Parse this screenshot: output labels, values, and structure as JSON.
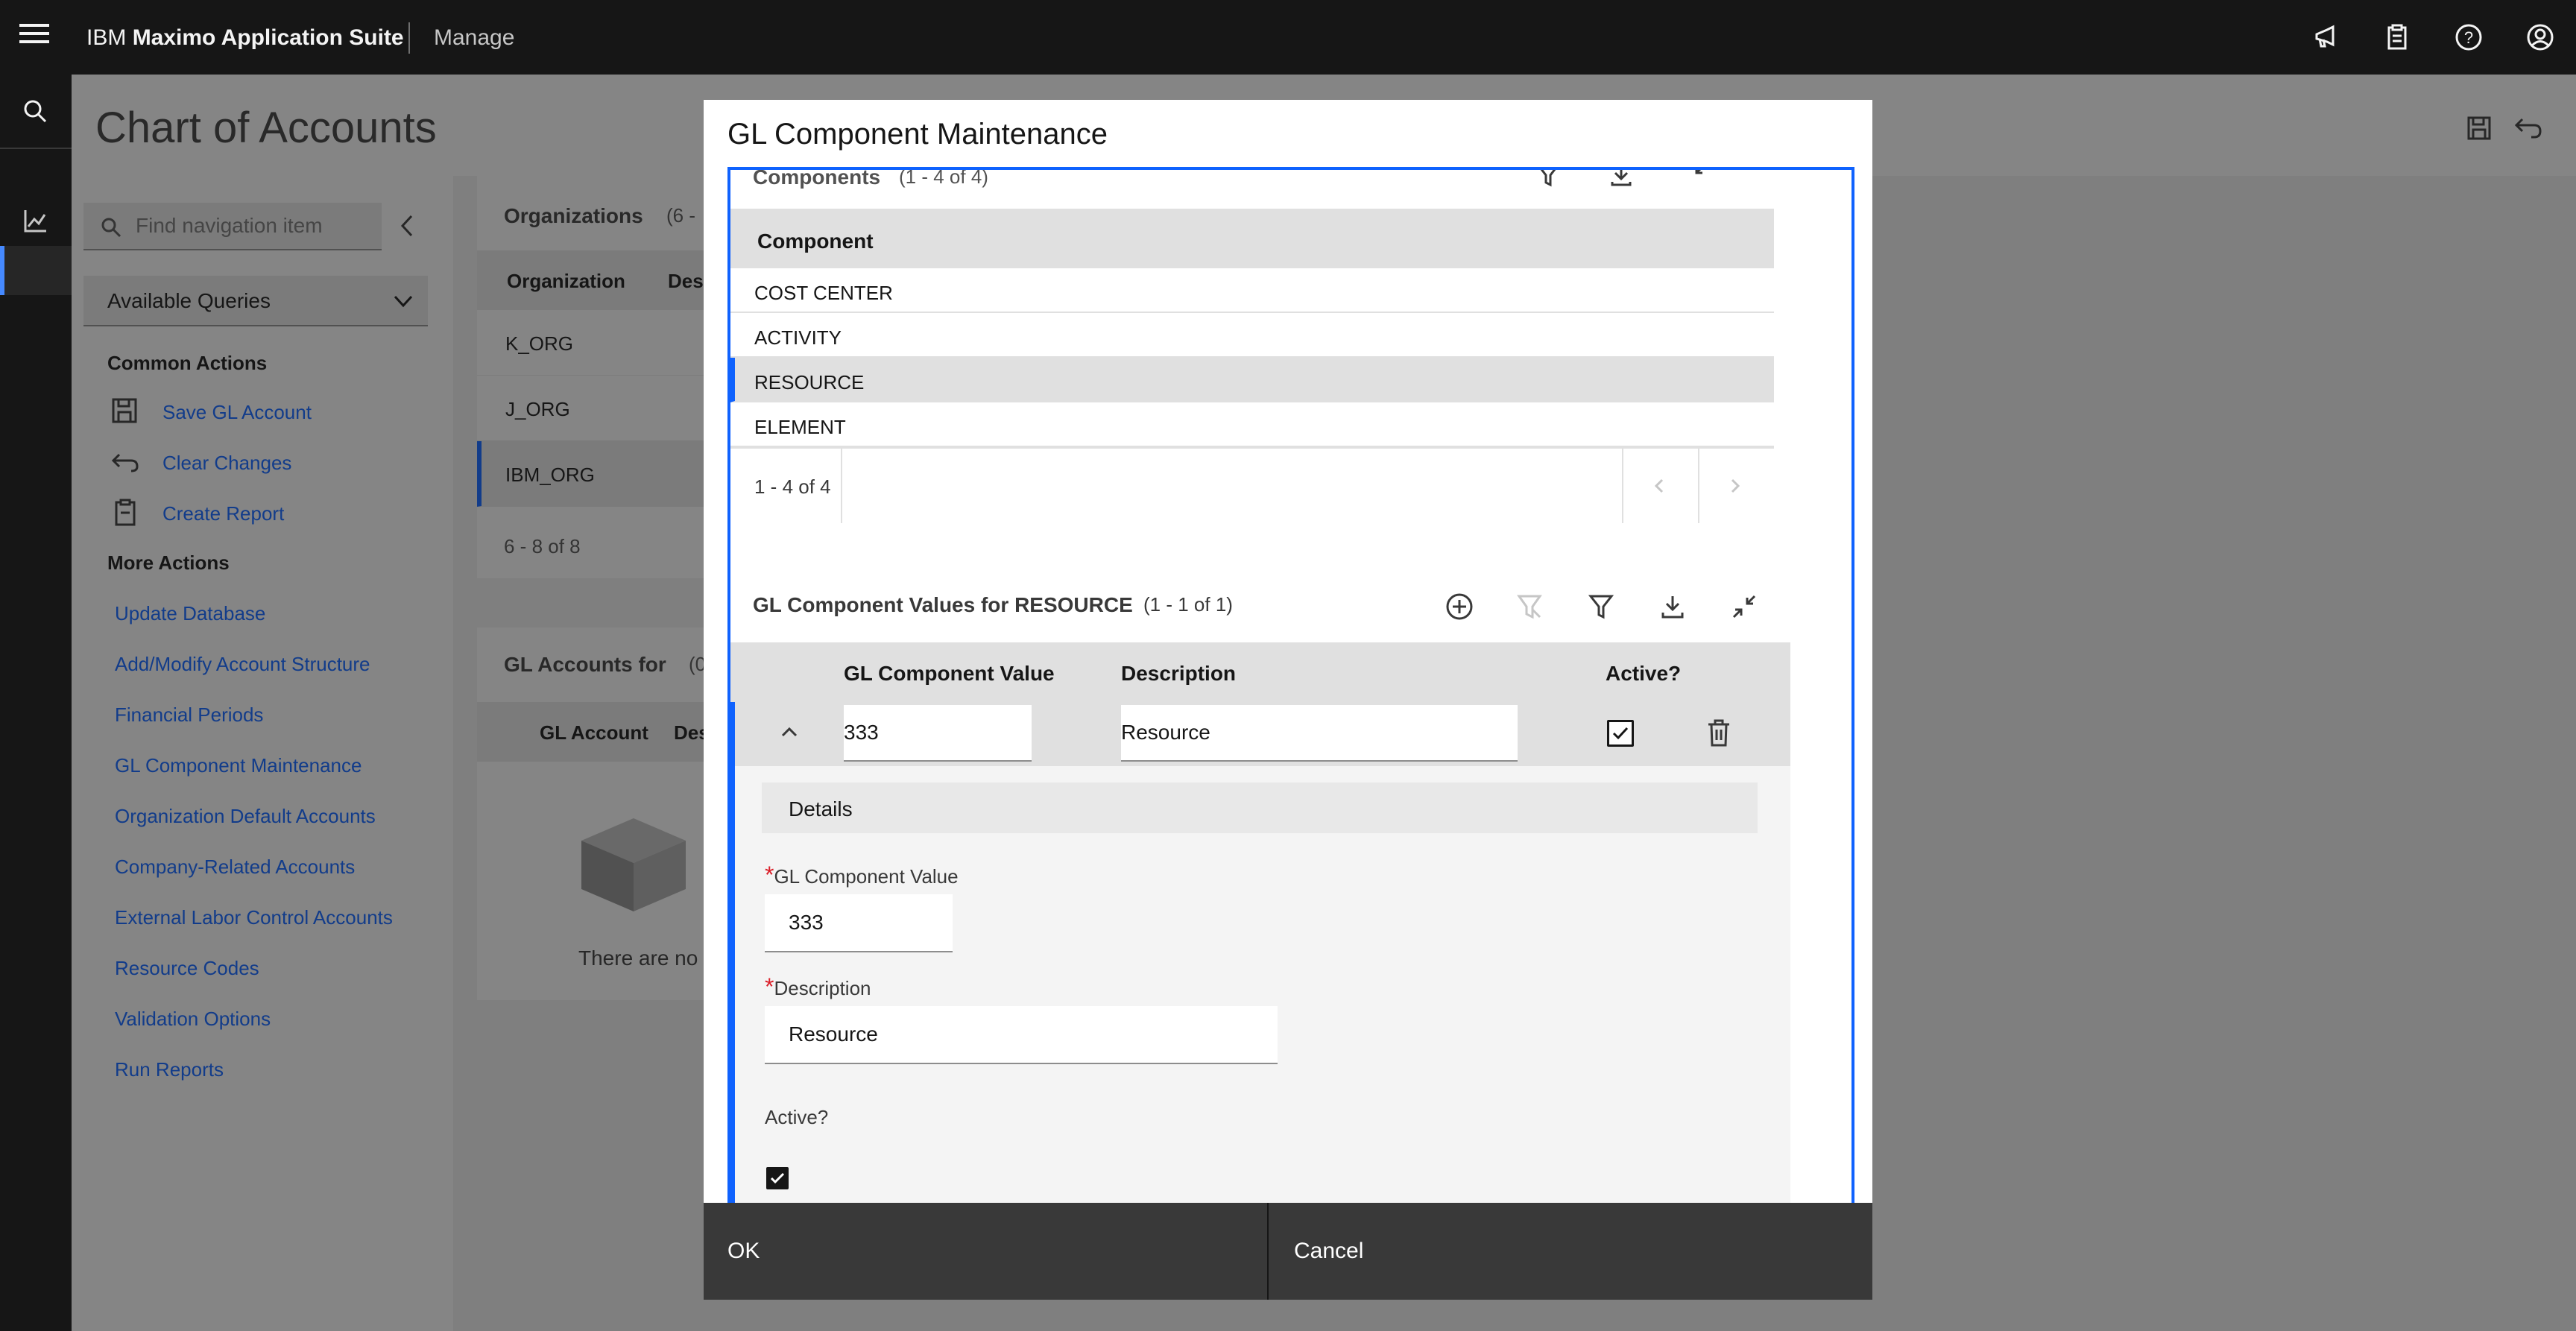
{
  "header": {
    "brand_prefix": "IBM",
    "brand_name": "Maximo Application Suite",
    "module": "Manage"
  },
  "page": {
    "title": "Chart of Accounts"
  },
  "leftnav": {
    "search_placeholder": "Find navigation item",
    "queries_label": "Available Queries",
    "common_actions_title": "Common Actions",
    "common_actions": [
      "Save GL Account",
      "Clear Changes",
      "Create Report"
    ],
    "more_actions_title": "More Actions",
    "more_actions": [
      "Update Database",
      "Add/Modify Account Structure",
      "Financial Periods",
      "GL Component Maintenance",
      "Organization Default Accounts",
      "Company-Related Accounts",
      "External Labor Control Accounts",
      "Resource Codes",
      "Validation Options",
      "Run Reports"
    ]
  },
  "background": {
    "organizations_title": "Organizations",
    "organizations_count": "(6 -",
    "org_col1": "Organization",
    "org_col2": "Desc",
    "orgs": [
      "K_ORG",
      "J_ORG",
      "IBM_ORG"
    ],
    "org_pager": "6 - 8 of 8",
    "glaccounts_title": "GL Accounts for",
    "glaccounts_count": "(0",
    "gl_col1": "GL Account",
    "gl_col2": "Des",
    "empty_text": "There are no"
  },
  "modal": {
    "title": "GL Component Maintenance",
    "components_title": "Components",
    "components_count": "(1 - 4 of 4)",
    "components_header": "Component",
    "components": [
      "COST CENTER",
      "ACTIVITY",
      "RESOURCE",
      "ELEMENT"
    ],
    "components_pager": "1 - 4 of 4",
    "values_title": "GL Component Values for RESOURCE",
    "values_count": "(1 - 1 of 1)",
    "values_headers": {
      "value": "GL Component Value",
      "description": "Description",
      "active": "Active?"
    },
    "row": {
      "value": "333",
      "description": "Resource",
      "active": true
    },
    "details_tab": "Details",
    "details": {
      "value_label": "GL Component Value",
      "value": "333",
      "description_label": "Description",
      "description": "Resource",
      "active_label": "Active?"
    },
    "ok_label": "OK",
    "cancel_label": "Cancel"
  },
  "colors": {
    "accent": "#0f62fe",
    "header_bg": "#161616",
    "required": "#da1e28"
  },
  "icons": [
    "menu-icon",
    "announcement-icon",
    "clipboard-icon",
    "help-icon",
    "user-icon",
    "search-icon",
    "chart-icon",
    "save-icon",
    "undo-icon",
    "filter-icon",
    "download-icon",
    "collapse-icon",
    "add-icon",
    "clear-filter-icon",
    "trash-icon",
    "chevron-up-icon",
    "chevron-down-icon",
    "chevron-left-icon",
    "empty-box-icon"
  ]
}
